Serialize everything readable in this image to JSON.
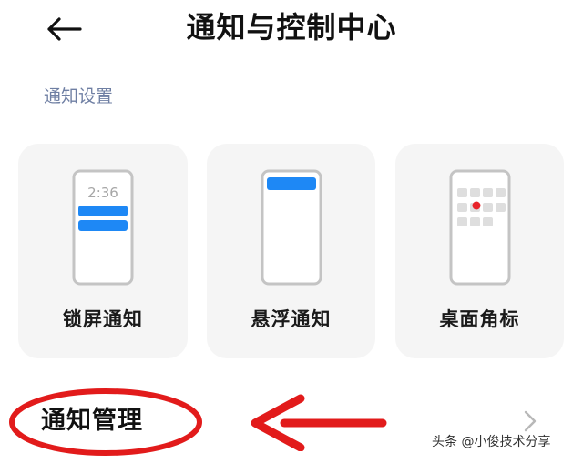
{
  "header": {
    "title": "通知与控制中心",
    "back_icon": "arrow-left-icon"
  },
  "section": {
    "label": "通知设置"
  },
  "cards": [
    {
      "label": "锁屏通知",
      "illustration": "lock-screen-phone-icon",
      "clock_text": "2:36"
    },
    {
      "label": "悬浮通知",
      "illustration": "floating-notification-phone-icon"
    },
    {
      "label": "桌面角标",
      "illustration": "app-badge-phone-icon"
    }
  ],
  "manage": {
    "label": "通知管理",
    "chevron_icon": "chevron-right-icon"
  },
  "watermark": {
    "text": "头条 @小俊技术分享"
  },
  "colors": {
    "accent_blue": "#1e88f5",
    "badge_red": "#e8232a",
    "annotation_red": "#e21b1b",
    "section_label": "#6f7fa3",
    "card_bg": "#f5f5f5"
  }
}
